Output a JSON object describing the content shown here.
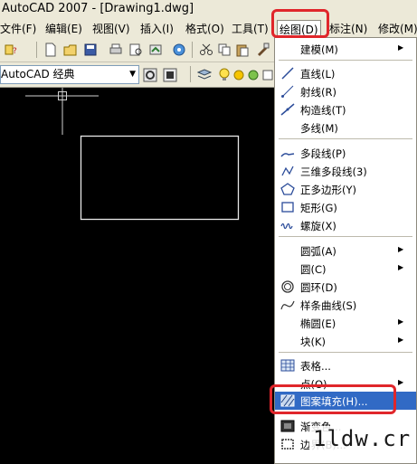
{
  "window": {
    "title": "AutoCAD 2007 - [Drawing1.dwg]"
  },
  "menubar": [
    {
      "label": "文件(F)"
    },
    {
      "label": "编辑(E)"
    },
    {
      "label": "视图(V)"
    },
    {
      "label": "插入(I)"
    },
    {
      "label": "格式(O)"
    },
    {
      "label": "工具(T)"
    },
    {
      "label": "绘图(D)"
    },
    {
      "label": "标注(N)"
    },
    {
      "label": "修改(M)"
    }
  ],
  "toolbar": {
    "workspace_value": "AutoCAD 经典"
  },
  "draw_menu": {
    "items": [
      {
        "label": "建模(M)",
        "icon": "none",
        "submenu": true
      },
      {
        "label": "直线(L)",
        "icon": "line-icon",
        "submenu": false
      },
      {
        "label": "射线(R)",
        "icon": "ray-icon",
        "submenu": false
      },
      {
        "label": "构造线(T)",
        "icon": "xline-icon",
        "submenu": false
      },
      {
        "label": "多线(M)",
        "icon": "none",
        "submenu": false
      },
      {
        "label": "多段线(P)",
        "icon": "polyline-icon",
        "submenu": false
      },
      {
        "label": "三维多段线(3)",
        "icon": "3d-polyline-icon",
        "submenu": false
      },
      {
        "label": "正多边形(Y)",
        "icon": "polygon-icon",
        "submenu": false
      },
      {
        "label": "矩形(G)",
        "icon": "rectangle-icon",
        "submenu": false
      },
      {
        "label": "螺旋(X)",
        "icon": "helix-icon",
        "submenu": false
      },
      {
        "label": "圆弧(A)",
        "icon": "none",
        "submenu": true
      },
      {
        "label": "圆(C)",
        "icon": "none",
        "submenu": true
      },
      {
        "label": "圆环(D)",
        "icon": "donut-icon",
        "submenu": false
      },
      {
        "label": "样条曲线(S)",
        "icon": "spline-icon",
        "submenu": false
      },
      {
        "label": "椭圆(E)",
        "icon": "none",
        "submenu": true
      },
      {
        "label": "块(K)",
        "icon": "none",
        "submenu": true
      },
      {
        "label": "表格...",
        "icon": "table-icon",
        "submenu": false
      },
      {
        "label": "点(O)",
        "icon": "none",
        "submenu": true
      },
      {
        "label": "图案填充(H)...",
        "icon": "hatch-icon",
        "submenu": false,
        "highlighted": true
      },
      {
        "label": "渐变色...",
        "icon": "gradient-icon",
        "submenu": false
      },
      {
        "label": "边界(B)...",
        "icon": "boundary-icon",
        "submenu": false
      }
    ]
  },
  "watermark": "1ldw.cr",
  "colors": {
    "highlight": "#316AC5",
    "annotation": "#E0262B",
    "canvas": "#000000",
    "chrome": "#ECE9D8"
  }
}
